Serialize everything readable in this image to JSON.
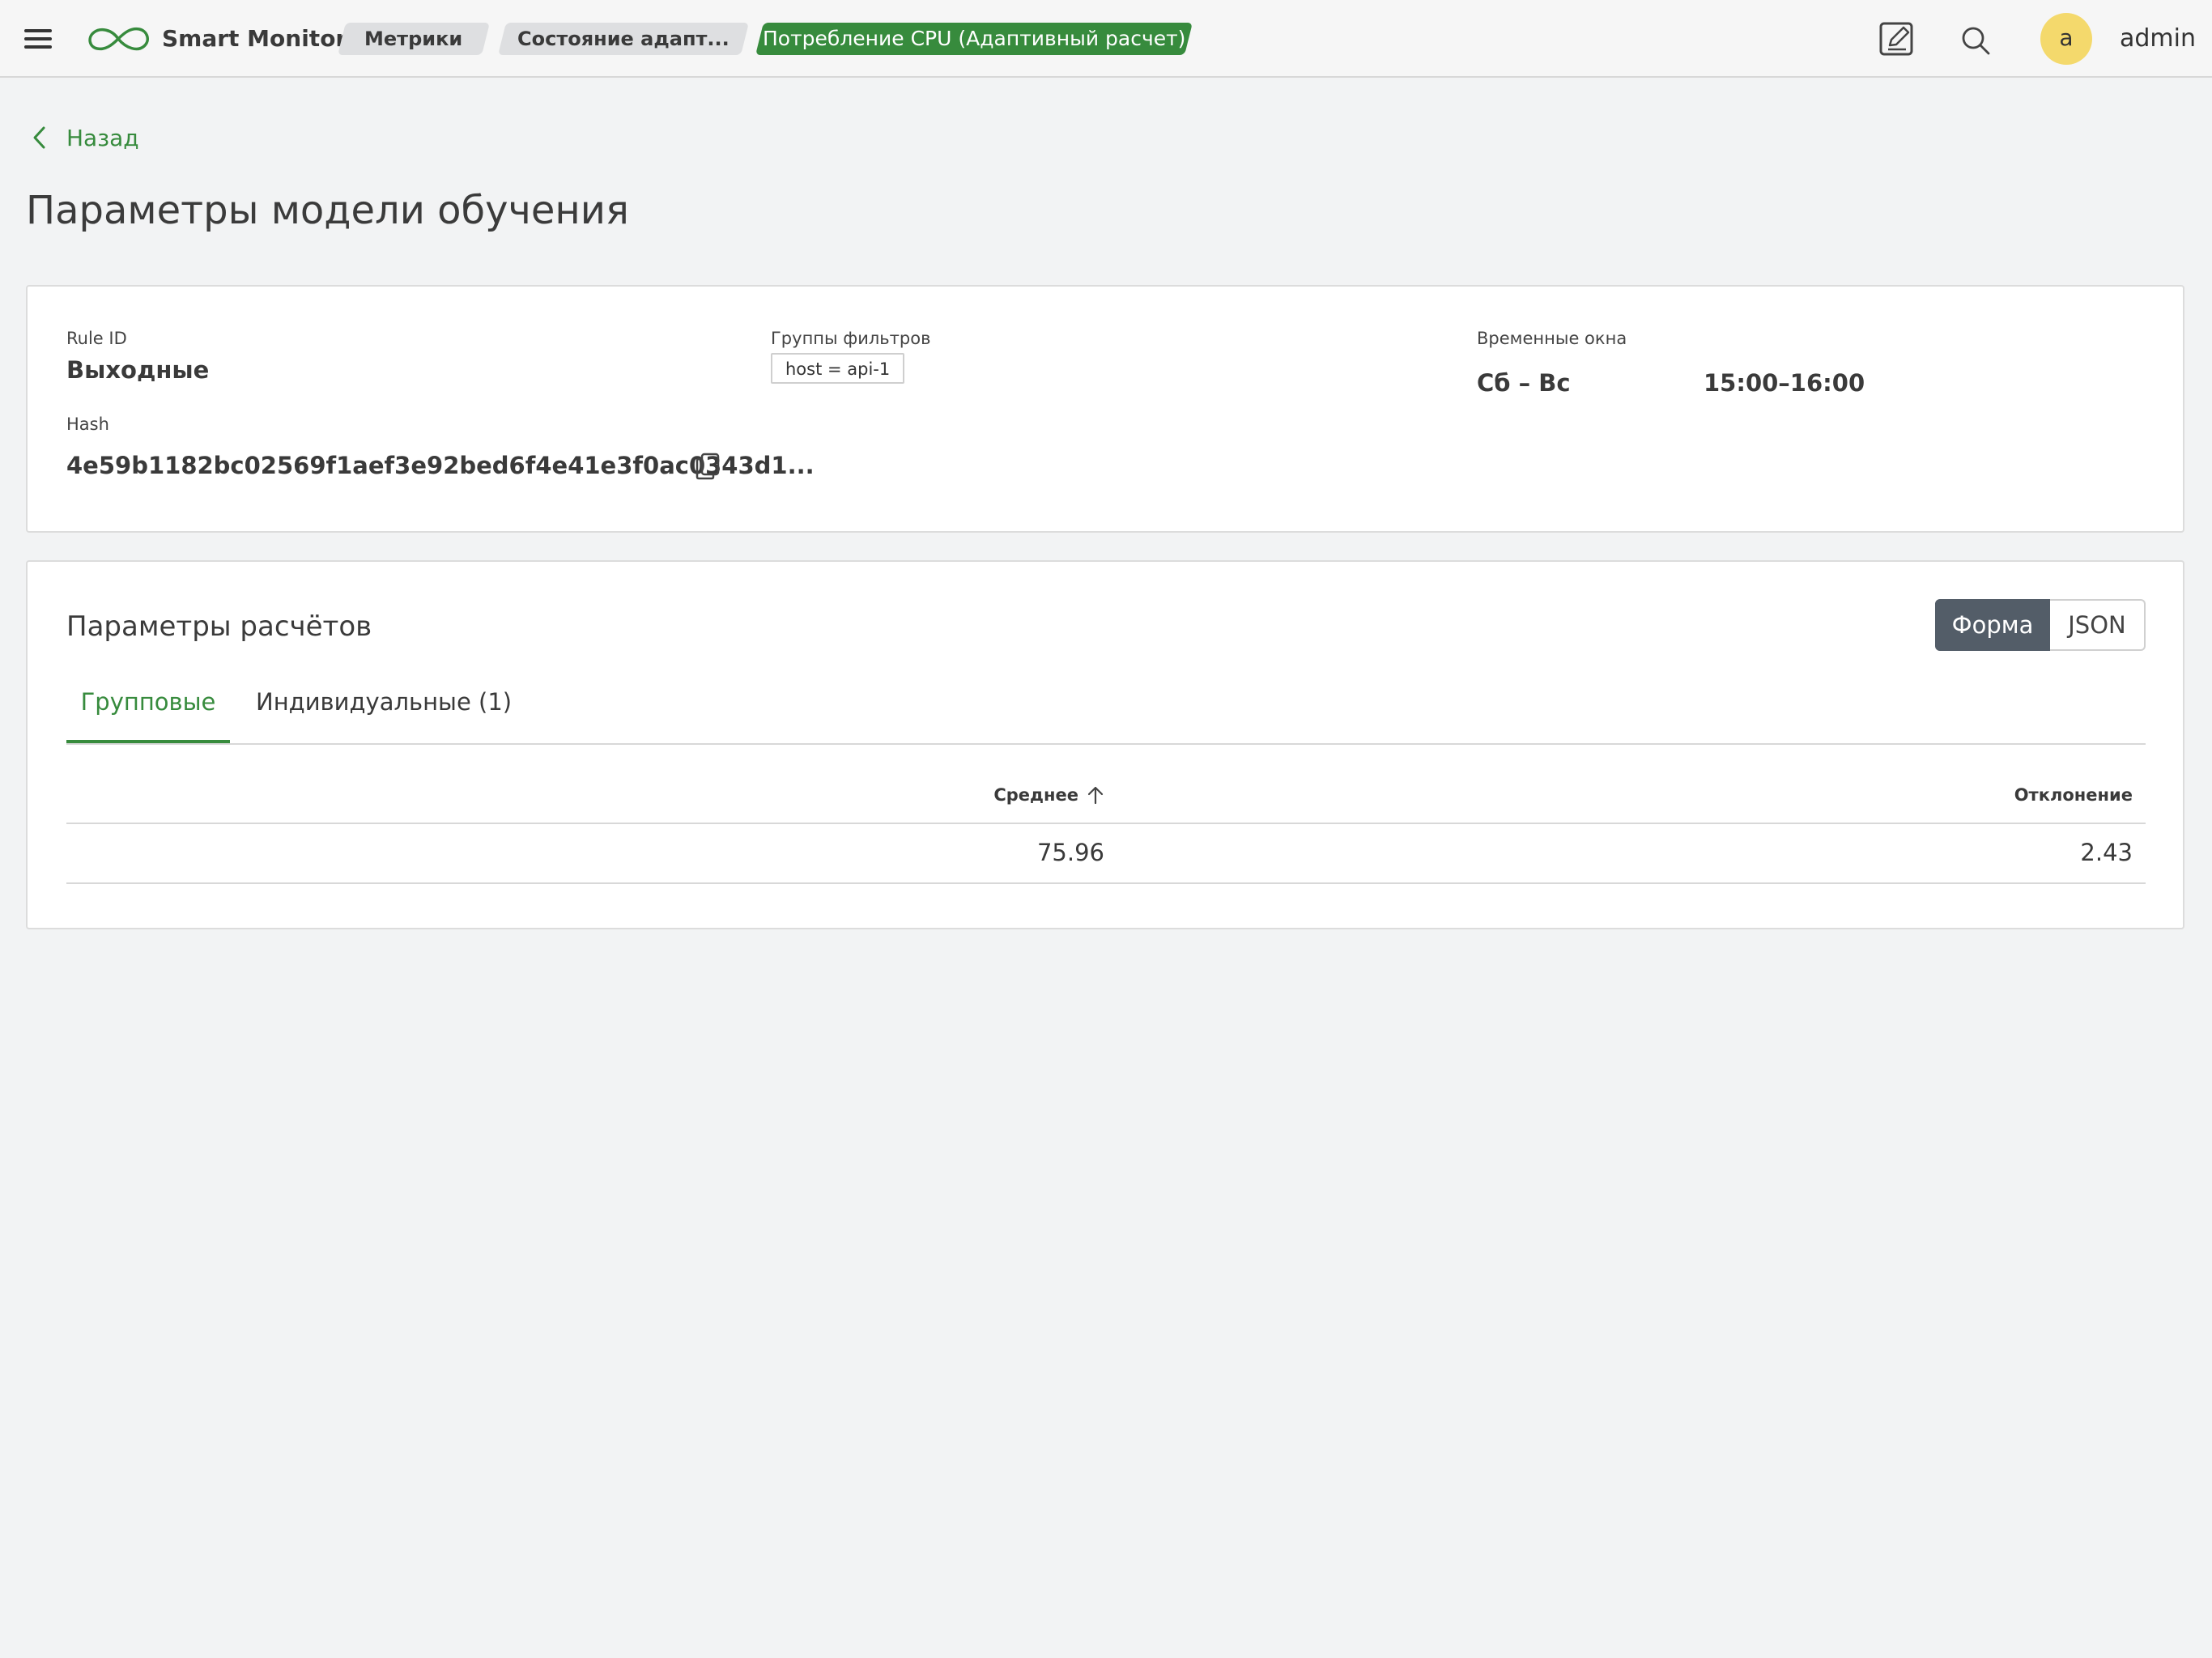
{
  "app": {
    "title": "Smart Monitor",
    "brand_color": "#378b3d"
  },
  "breadcrumbs": [
    "Метрики",
    "Состояние адапт...",
    "Потребление CPU (Адаптивный расчет)"
  ],
  "user": {
    "avatar_letter": "a",
    "name": "admin",
    "avatar_color": "#f4d96c"
  },
  "icons": {
    "menu": "hamburger-icon",
    "logo": "infinity-logo",
    "edit": "edit-icon",
    "search": "search-icon",
    "back": "chevron-left-icon",
    "copy": "copy-icon",
    "sort": "arrow-up-icon"
  },
  "nav": {
    "back_label": "Назад"
  },
  "page": {
    "title": "Параметры модели обучения"
  },
  "rule": {
    "rule_id_label": "Rule ID",
    "rule_id_value": "Выходные",
    "filters_label": "Группы фильтров",
    "filter_tag": "host = api-1",
    "windows_label": "Временные окна",
    "window_days": "Сб – Вс",
    "window_time": "15:00–16:00",
    "hash_label": "Hash",
    "hash_value": "4e59b1182bc02569f1aef3e92bed6f4e41e3f0ac0343d1..."
  },
  "calc": {
    "title": "Параметры расчётов",
    "view_toggle": {
      "form": "Форма",
      "json": "JSON",
      "selected": "Форма"
    },
    "tabs": [
      "Групповые",
      "Индивидуальные (1)"
    ],
    "active_tab": "Групповые",
    "table": {
      "columns": [
        "Среднее",
        "Отклонение"
      ],
      "sort_column": "Среднее",
      "rows": [
        {
          "mean": "75.96",
          "deviation": "2.43"
        }
      ]
    }
  }
}
